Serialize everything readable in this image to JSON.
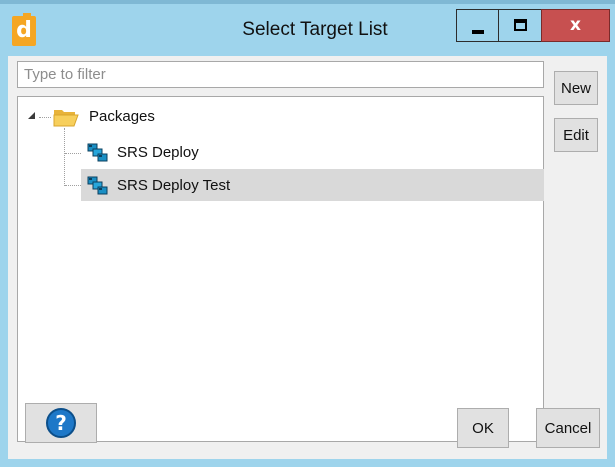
{
  "window": {
    "title": "Select Target List",
    "minimize_icon": "minimize-icon",
    "maximize_icon": "maximize-icon",
    "close_glyph": "x",
    "close_color": "#c75050",
    "app_icon_letter": "d",
    "app_icon_color": "#f5a623"
  },
  "filter": {
    "placeholder": "Type to filter",
    "value": ""
  },
  "tree": {
    "root": {
      "label": "Packages",
      "icon": "folder-icon",
      "expanded": true
    },
    "children": [
      {
        "label": "SRS Deploy",
        "icon": "package-icon",
        "selected": false
      },
      {
        "label": "SRS Deploy Test",
        "icon": "package-icon",
        "selected": true
      }
    ]
  },
  "actions": {
    "new_label": "New",
    "edit_label": "Edit"
  },
  "footer": {
    "help_glyph": "?",
    "help_icon": "help-icon",
    "ok_label": "OK",
    "cancel_label": "Cancel"
  }
}
